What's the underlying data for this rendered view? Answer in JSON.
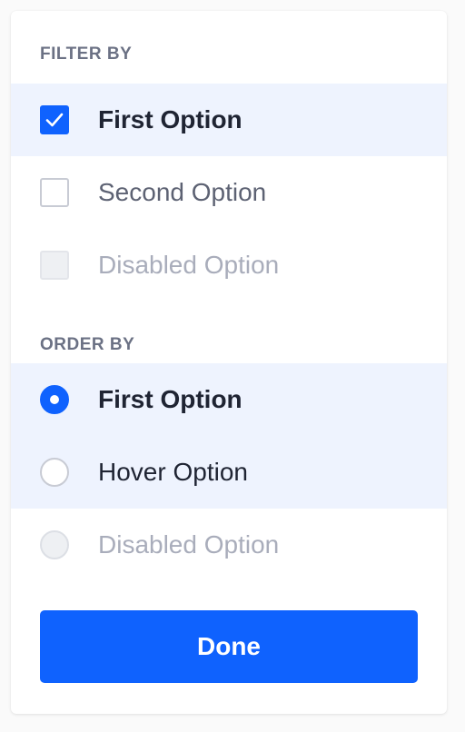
{
  "colors": {
    "accent": "#0f62fe",
    "highlight_row": "#eef3fe",
    "heading_text": "#6b7184",
    "disabled_text": "#a9adbb"
  },
  "filter": {
    "title": "FILTER BY",
    "options": [
      {
        "label": "First Option",
        "state": "checked"
      },
      {
        "label": "Second Option",
        "state": "unchecked"
      },
      {
        "label": "Disabled Option",
        "state": "disabled"
      }
    ]
  },
  "order": {
    "title": "ORDER BY",
    "options": [
      {
        "label": "First Option",
        "state": "selected"
      },
      {
        "label": "Hover Option",
        "state": "hover"
      },
      {
        "label": "Disabled Option",
        "state": "disabled"
      }
    ]
  },
  "actions": {
    "done_label": "Done"
  }
}
